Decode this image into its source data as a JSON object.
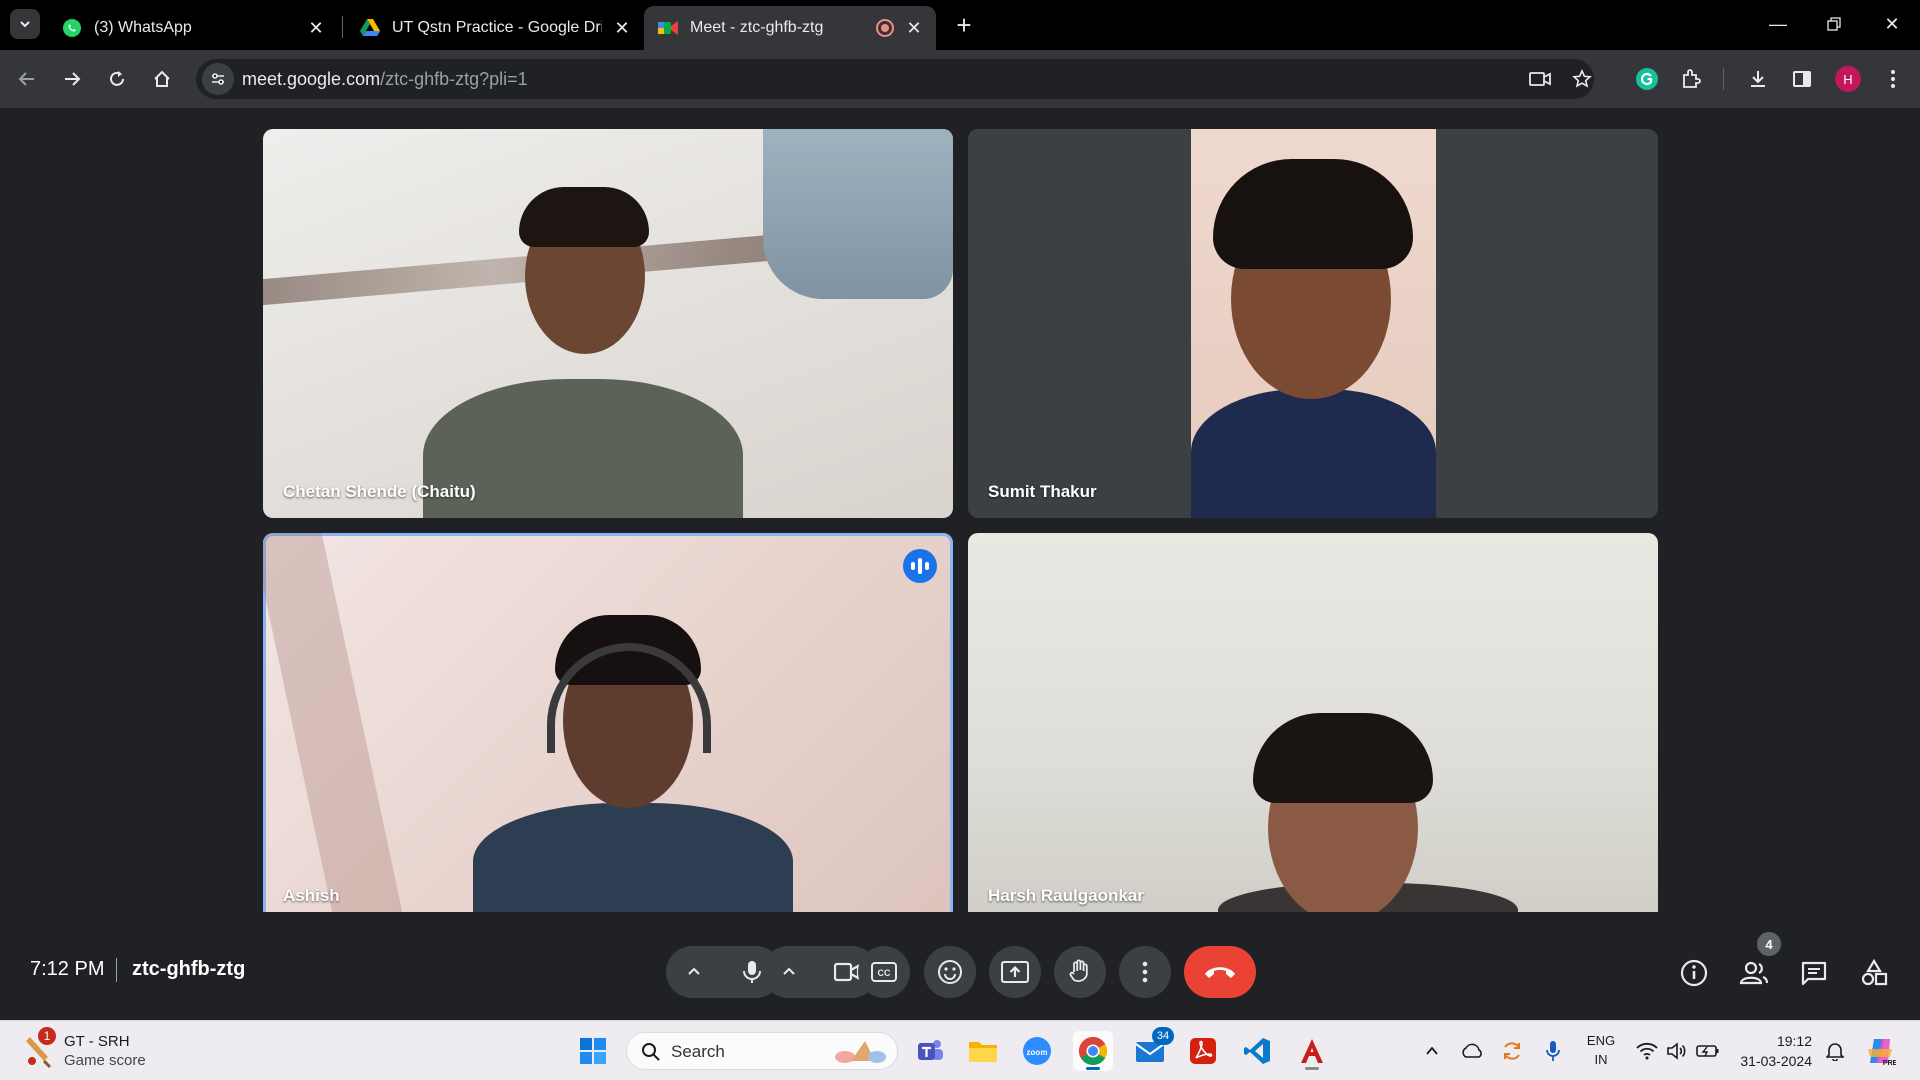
{
  "browser": {
    "tabs": [
      {
        "title": "(3) WhatsApp",
        "favicon": "whatsapp-icon",
        "active": false
      },
      {
        "title": "UT Qstn Practice - Google Drive",
        "favicon": "google-drive-icon",
        "active": false
      },
      {
        "title": "Meet - ztc-ghfb-ztg",
        "favicon": "google-meet-icon",
        "active": true,
        "recording": true
      }
    ],
    "url": {
      "host": "meet.google.com",
      "path": "/ztc-ghfb-ztg?pli=1"
    },
    "profile_initial": "H",
    "colors": {
      "profile": "#c2185b",
      "grammarly": "#15c39a"
    }
  },
  "meet": {
    "participants": [
      {
        "name": "Chetan Shende (Chaitu)",
        "speaking": false
      },
      {
        "name": "Sumit Thakur",
        "speaking": false
      },
      {
        "name": "Ashish",
        "speaking": true
      },
      {
        "name": "Harsh Raulgaonkar",
        "speaking": false
      }
    ],
    "time": "7:12 PM",
    "meeting_code": "ztc-ghfb-ztg",
    "people_count": "4",
    "colors": {
      "accent": "#8ab4f8",
      "end_call": "#ea4335",
      "speaking_badge": "#1a73e8"
    }
  },
  "taskbar": {
    "weather": {
      "title": "GT - SRH",
      "subtitle": "Game score",
      "badge": "1"
    },
    "search_placeholder": "Search",
    "mail_badge": "34",
    "language": {
      "line1": "ENG",
      "line2": "IN"
    },
    "clock": {
      "time": "19:12",
      "date": "31-03-2024"
    },
    "pinned_apps": [
      "windows-start-icon",
      "search-icon",
      "teams-icon",
      "file-explorer-icon",
      "zoom-icon",
      "chrome-icon",
      "mail-icon",
      "acrobat-icon",
      "vscode-icon",
      "autocad-icon"
    ]
  }
}
